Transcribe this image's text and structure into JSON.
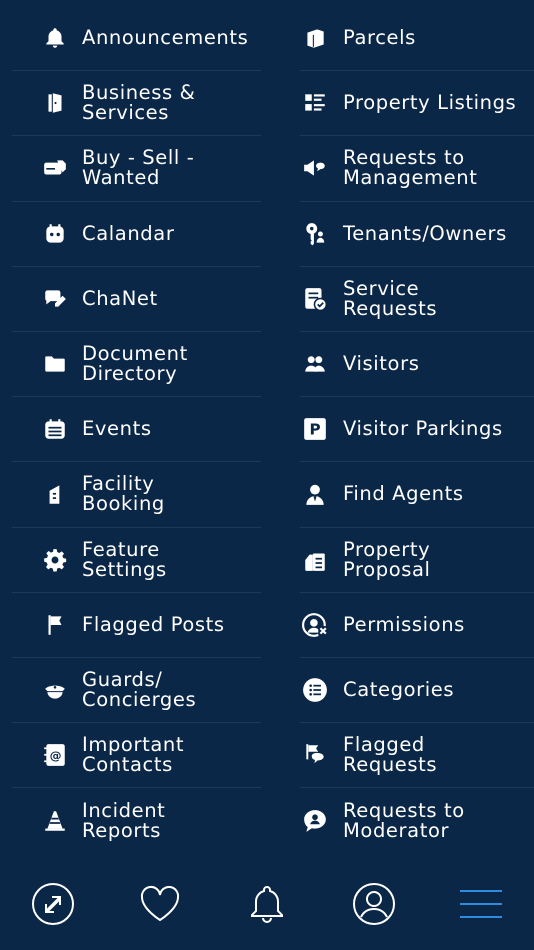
{
  "menu": {
    "left": [
      {
        "label": "Announcements",
        "icon": "bell-icon"
      },
      {
        "label": "Business & Services",
        "icon": "door-icon"
      },
      {
        "label": "Buy - Sell - Wanted",
        "icon": "tag-card-icon"
      },
      {
        "label": "Calandar",
        "icon": "calendar-face-icon"
      },
      {
        "label": "ChaNet",
        "icon": "chat-edit-icon"
      },
      {
        "label": "Document Directory",
        "icon": "folder-icon"
      },
      {
        "label": "Events",
        "icon": "calendar-icon"
      },
      {
        "label": "Facility Booking",
        "icon": "building-icon"
      },
      {
        "label": "Feature Settings",
        "icon": "gear-icon"
      },
      {
        "label": "Flagged Posts",
        "icon": "flag-icon"
      },
      {
        "label": "Guards/ Concierges",
        "icon": "guard-cap-icon"
      },
      {
        "label": "Important Contacts",
        "icon": "contact-book-icon"
      },
      {
        "label": "Incident Reports",
        "icon": "traffic-cone-icon"
      }
    ],
    "right": [
      {
        "label": "Parcels",
        "icon": "parcel-icon"
      },
      {
        "label": "Property Listings",
        "icon": "list-icon"
      },
      {
        "label": "Requests to Management",
        "icon": "megaphone-chat-icon"
      },
      {
        "label": "Tenants/Owners",
        "icon": "key-person-icon"
      },
      {
        "label": "Service Requests",
        "icon": "checklist-icon"
      },
      {
        "label": "Visitors",
        "icon": "people-icon"
      },
      {
        "label": "Visitor Parkings",
        "icon": "parking-icon"
      },
      {
        "label": "Find Agents",
        "icon": "agent-icon"
      },
      {
        "label": "Property Proposal",
        "icon": "proposal-icon"
      },
      {
        "label": "Permissions",
        "icon": "user-x-icon"
      },
      {
        "label": "Categories",
        "icon": "categories-icon"
      },
      {
        "label": "Flagged Requests",
        "icon": "flag-chat-icon"
      },
      {
        "label": "Requests to Moderator",
        "icon": "moderator-chat-icon"
      }
    ]
  },
  "tabbar": {
    "items": [
      {
        "icon": "transfer-icon"
      },
      {
        "icon": "heart-icon"
      },
      {
        "icon": "bell-icon"
      },
      {
        "icon": "profile-icon"
      },
      {
        "icon": "menu-icon",
        "active": true
      }
    ],
    "active_color": "#2f8be0"
  }
}
